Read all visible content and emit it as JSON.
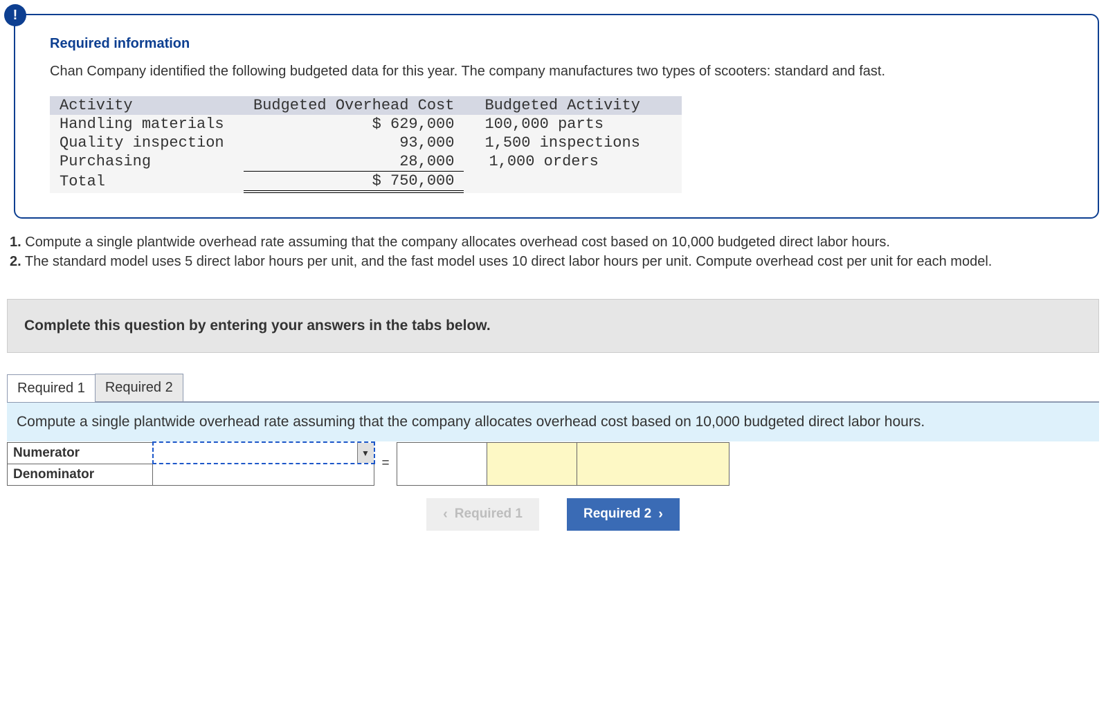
{
  "info": {
    "badge": "!",
    "heading": "Required information",
    "intro": "Chan Company identified the following budgeted data for this year. The company manufactures two types of scooters: standard and fast."
  },
  "chart_data": {
    "type": "table",
    "title": "Budgeted Overhead Data",
    "columns": [
      "Activity",
      "Budgeted Overhead Cost",
      "Budgeted Activity"
    ],
    "rows": [
      {
        "activity": "Handling materials",
        "cost": "$ 629,000",
        "budgeted_activity": "100,000 parts"
      },
      {
        "activity": "Quality inspection",
        "cost": "93,000",
        "budgeted_activity": "1,500 inspections"
      },
      {
        "activity": "Purchasing",
        "cost": "28,000",
        "budgeted_activity": "1,000 orders"
      }
    ],
    "total_row": {
      "activity": "Total",
      "cost": "$ 750,000"
    }
  },
  "questions": {
    "q1_num": "1.",
    "q1": " Compute a single plantwide overhead rate assuming that the company allocates overhead cost based on 10,000 budgeted direct labor hours.",
    "q2_num": "2.",
    "q2": " The standard model uses 5 direct labor hours per unit, and the fast model uses 10 direct labor hours per unit. Compute overhead cost per unit for each model."
  },
  "banner": "Complete this question by entering your answers in the tabs below.",
  "tabs": {
    "t1": "Required 1",
    "t2": "Required 2"
  },
  "sub_instruction": "Compute a single plantwide overhead rate assuming that the company allocates overhead cost based on 10,000 budgeted direct labor hours.",
  "answer": {
    "numerator_label": "Numerator",
    "denominator_label": "Denominator",
    "equals": "="
  },
  "nav": {
    "prev": "Required 1",
    "next": "Required 2"
  }
}
